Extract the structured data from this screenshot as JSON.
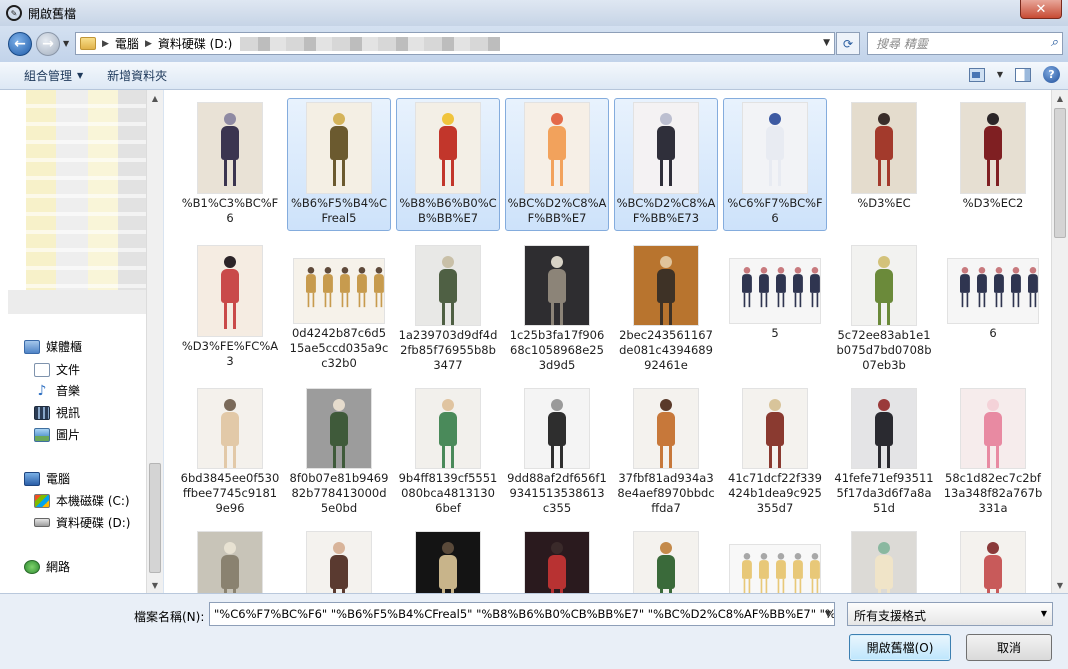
{
  "window": {
    "title": "開啟舊檔",
    "close_label": "✕"
  },
  "address": {
    "crumbs": [
      "電腦",
      "資料硬碟 (D:)"
    ],
    "search_placeholder": "搜尋 精靈"
  },
  "toolbar": {
    "organize": "組合管理",
    "new_folder": "新增資料夾"
  },
  "nav": {
    "libraries": "媒體櫃",
    "documents": "文件",
    "music": "音樂",
    "videos": "視訊",
    "pictures": "圖片",
    "computer": "電腦",
    "drive_c": "本機磁碟 (C:)",
    "drive_d": "資料硬碟 (D:)",
    "network": "網路"
  },
  "files": [
    {
      "name": "%B1%C3%BC%F6",
      "selected": false,
      "palette": [
        "#e9e2d6",
        "#3b3550",
        "#8f8aa3"
      ]
    },
    {
      "name": "%B6%F5%B4%CFreal5",
      "selected": true,
      "palette": [
        "#f4efe4",
        "#6b5a2f",
        "#d4b35a"
      ]
    },
    {
      "name": "%B8%B6%B0%CB%BB%E7",
      "selected": true,
      "palette": [
        "#f3efe6",
        "#c2362b",
        "#f0c43c"
      ]
    },
    {
      "name": "%BC%D2%C8%AF%BB%E7",
      "selected": true,
      "palette": [
        "#f6efe6",
        "#f2a25c",
        "#e46a4a"
      ]
    },
    {
      "name": "%BC%D2%C8%AF%BB%E73",
      "selected": true,
      "palette": [
        "#f4f2f3",
        "#2f2f3a",
        "#bcbfd0"
      ]
    },
    {
      "name": "%C6%F7%BC%F6",
      "selected": true,
      "palette": [
        "#f2f3f6",
        "#e8ebf2",
        "#3d5aa2"
      ]
    },
    {
      "name": "%D3%EC",
      "selected": false,
      "palette": [
        "#e4dccd",
        "#a33a2c",
        "#3a2e2a"
      ]
    },
    {
      "name": "%D3%EC2",
      "selected": false,
      "palette": [
        "#e6dfd2",
        "#7f1f22",
        "#2c2628"
      ]
    },
    {
      "name": "%D3%FE%FC%A3",
      "selected": false,
      "palette": [
        "#f5ece2",
        "#c94a4a",
        "#2c2428"
      ]
    },
    {
      "name": "0d4242b87c6d515ae5ccd035a9cc32b0",
      "selected": false,
      "palette": [
        "#f6f2ea",
        "#c79b4e",
        "#5f4a3a"
      ],
      "wide": true
    },
    {
      "name": "1a239703d9df4d2fb85f76955b8b3477",
      "selected": false,
      "palette": [
        "#e8e8e6",
        "#4f6044",
        "#c9c0a8"
      ]
    },
    {
      "name": "1c25b3fa17f90668c1058968e253d9d5",
      "selected": false,
      "palette": [
        "#2e2d30",
        "#8c8478",
        "#d8d2c6"
      ]
    },
    {
      "name": "2bec243561167de081c439468992461e",
      "selected": false,
      "palette": [
        "#b8742e",
        "#3e3226",
        "#e0c39a"
      ]
    },
    {
      "name": "5",
      "selected": false,
      "palette": [
        "#f6f6f6",
        "#2f3550",
        "#c87a7e"
      ],
      "wide": true
    },
    {
      "name": "5c72ee83ab1e1b075d7bd0708b07eb3b",
      "selected": false,
      "palette": [
        "#f2f2f0",
        "#6b8a3a",
        "#d3c27a"
      ]
    },
    {
      "name": "6",
      "selected": false,
      "palette": [
        "#f6f6f6",
        "#2f3550",
        "#c87a7e"
      ],
      "wide": true
    },
    {
      "name": "6bd3845ee0f530ffbee7745c91819e96",
      "selected": false,
      "palette": [
        "#f4f1ec",
        "#e2c9a8",
        "#7a6a5a"
      ]
    },
    {
      "name": "8f0b07e81b946982b778413000d5e0bd",
      "selected": false,
      "palette": [
        "#9c9c9c",
        "#3f5a3a",
        "#e6dccd"
      ]
    },
    {
      "name": "9b4ff8139cf5551080bca48131306bef",
      "selected": false,
      "palette": [
        "#f2f0ec",
        "#4a8a5a",
        "#e0c4a0"
      ]
    },
    {
      "name": "9dd88af2df656f19341513538613c355",
      "selected": false,
      "palette": [
        "#f4f4f4",
        "#2e2e2e",
        "#9a9a9a"
      ]
    },
    {
      "name": "37fbf81ad934a38e4aef8970bbdcffda7",
      "selected": false,
      "palette": [
        "#f4f2ee",
        "#c7783a",
        "#5a3a2a"
      ]
    },
    {
      "name": "41c71dcf22f339424b1dea9c925355d7",
      "selected": false,
      "palette": [
        "#f4f2ee",
        "#8a3a30",
        "#d8c49a"
      ]
    },
    {
      "name": "41fefe71ef935115f17da3d6f7a8a51d",
      "selected": false,
      "palette": [
        "#e4e4e6",
        "#2a2a30",
        "#9a3a3a"
      ]
    },
    {
      "name": "58c1d82ec7c2bf13a348f82a767b331a",
      "selected": false,
      "palette": [
        "#f6ecec",
        "#e88aa2",
        "#f4d2d8"
      ]
    },
    {
      "name": "",
      "selected": false,
      "palette": [
        "#c8c4b8",
        "#8a8270",
        "#e8e2d2"
      ]
    },
    {
      "name": "",
      "selected": false,
      "palette": [
        "#f4f2ee",
        "#5a3a30",
        "#d8b49a"
      ]
    },
    {
      "name": "",
      "selected": false,
      "palette": [
        "#141414",
        "#c8b48a",
        "#5a4a3a"
      ]
    },
    {
      "name": "",
      "selected": false,
      "palette": [
        "#2a1a1e",
        "#b83232",
        "#3a2a2a"
      ]
    },
    {
      "name": "",
      "selected": false,
      "palette": [
        "#f4f2ee",
        "#3a6a3a",
        "#c48a4a"
      ]
    },
    {
      "name": "",
      "selected": false,
      "palette": [
        "#f8f8f8",
        "#e8c878",
        "#a8a8a8"
      ],
      "wide": true
    },
    {
      "name": "",
      "selected": false,
      "palette": [
        "#dcdad6",
        "#f0e4c8",
        "#8ab8a0"
      ]
    },
    {
      "name": "",
      "selected": false,
      "palette": [
        "#f4f2ee",
        "#c85a5a",
        "#8a3a3a"
      ]
    }
  ],
  "bottom": {
    "filename_label": "檔案名稱(N):",
    "filename_value": "\"%C6%F7%BC%F6\" \"%B6%F5%B4%CFreal5\" \"%B8%B6%B0%CB%BB%E7\" \"%BC%D2%C8%AF%BB%E7\" \"%I",
    "filetype": "所有支援格式",
    "open_label": "開啟舊檔(O)",
    "cancel_label": "取消"
  }
}
